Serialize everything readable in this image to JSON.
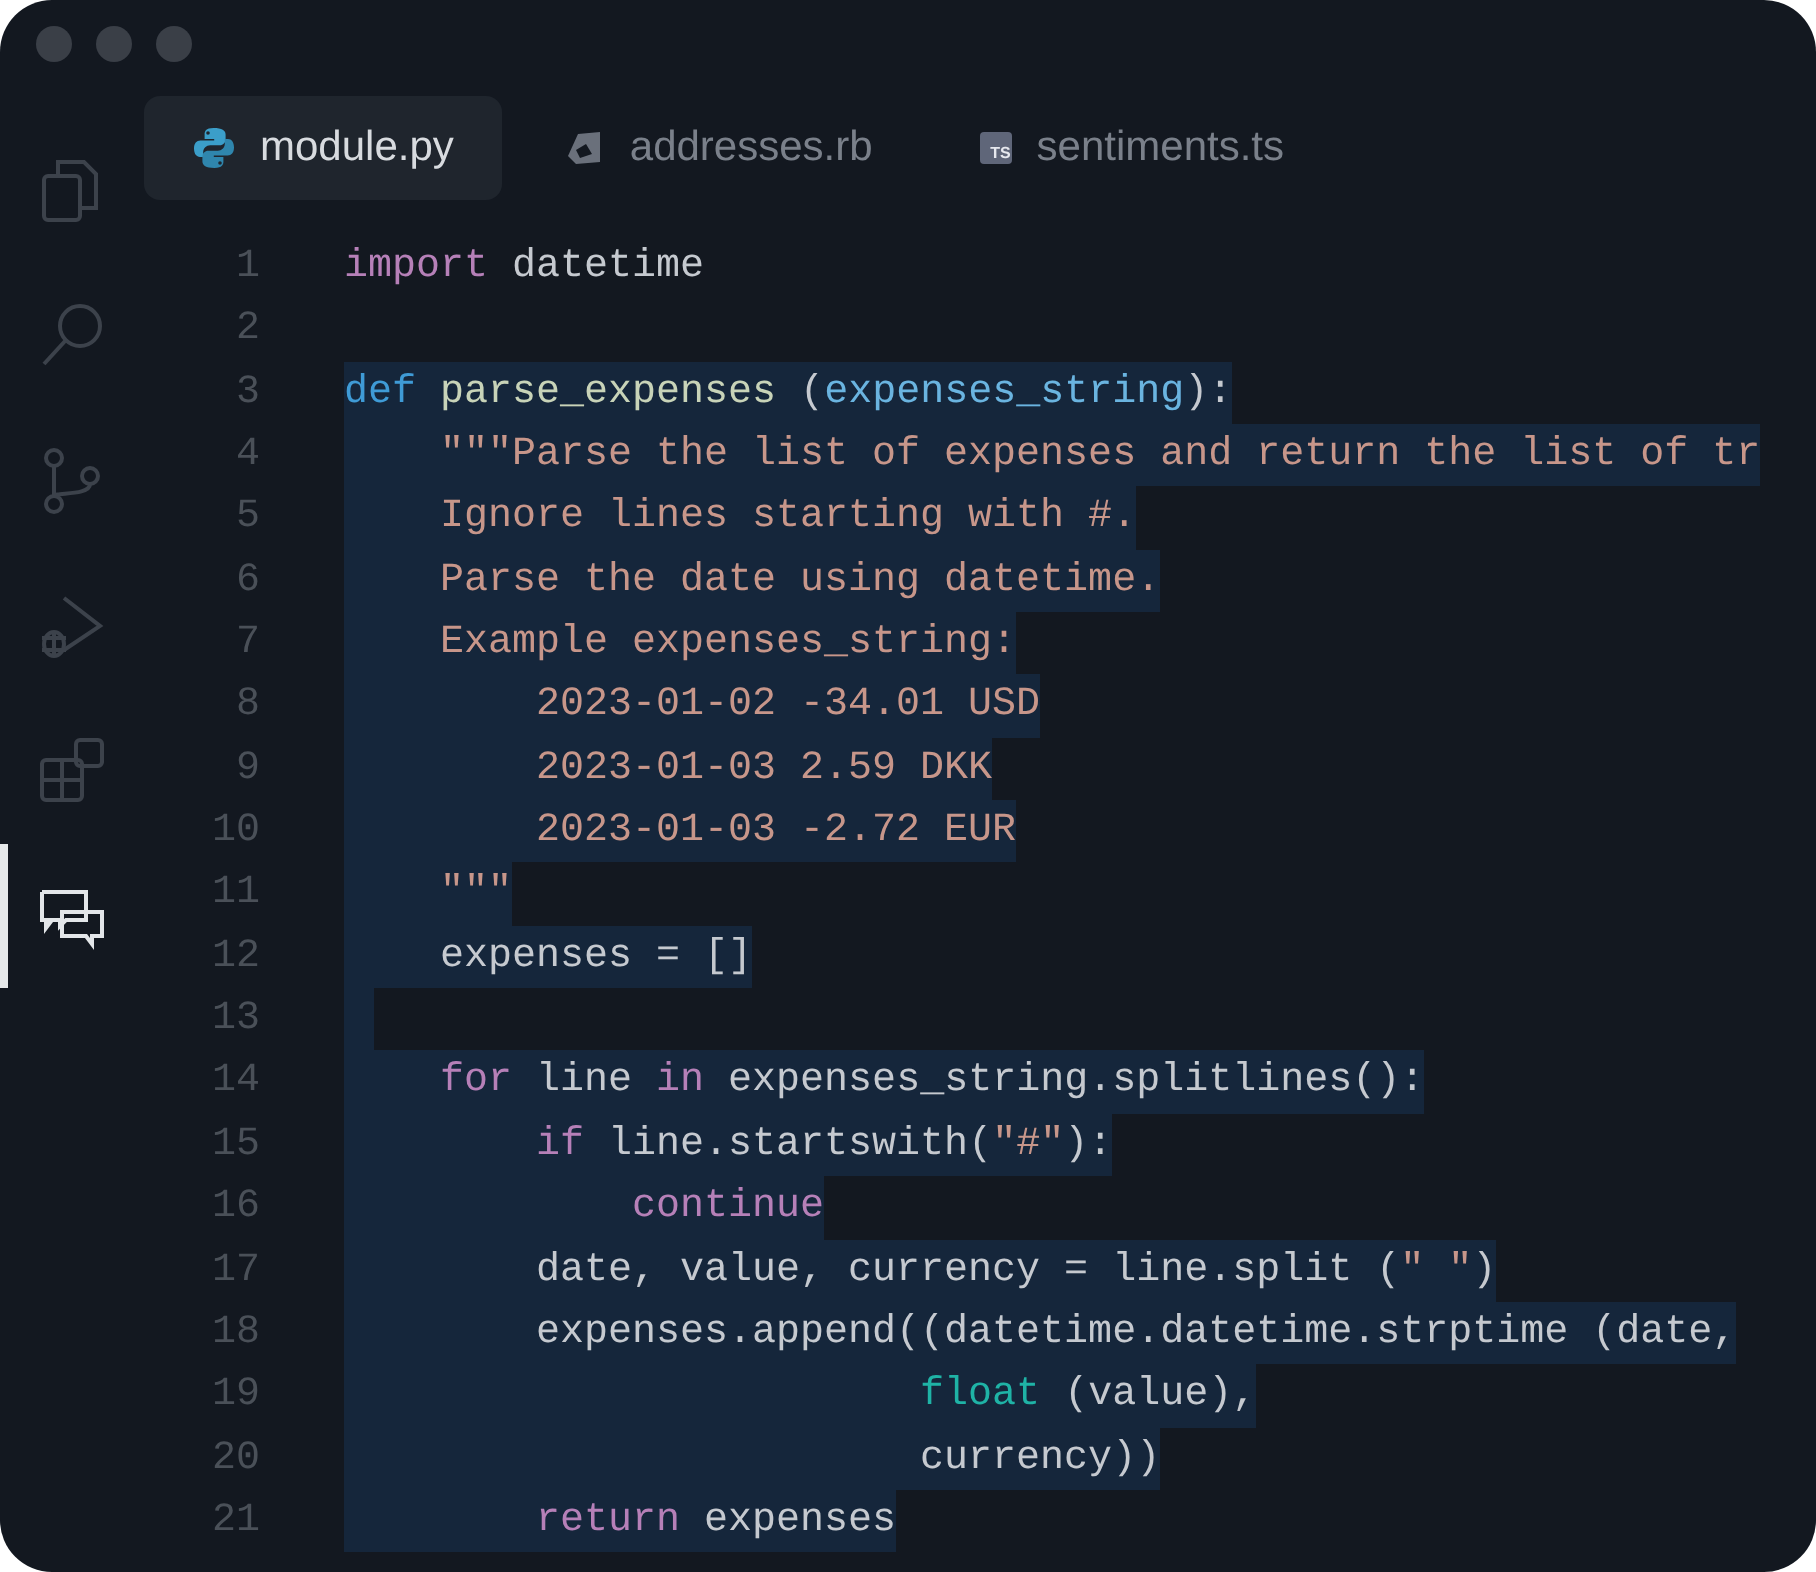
{
  "activity_bar": [
    {
      "kind": "files",
      "selected": false
    },
    {
      "kind": "search",
      "selected": false
    },
    {
      "kind": "branch",
      "selected": false
    },
    {
      "kind": "debug",
      "selected": false
    },
    {
      "kind": "extensions",
      "selected": false
    },
    {
      "kind": "chat",
      "selected": true
    }
  ],
  "tabs": [
    {
      "label": "module.py",
      "kind": "python",
      "selected": true
    },
    {
      "label": "addresses.rb",
      "kind": "ruby",
      "selected": false
    },
    {
      "label": "sentiments.ts",
      "kind": "typescript",
      "icon_text": "TS",
      "selected": false
    }
  ],
  "editor": {
    "lines": [
      {
        "number": "1",
        "selected": false,
        "tokens": [
          {
            "kind": "keyword",
            "text": "import"
          },
          {
            "kind": "plain",
            "text": " datetime"
          }
        ]
      },
      {
        "number": "2",
        "selected": false
      },
      {
        "number": "3",
        "selected": true,
        "tokens": [
          {
            "kind": "def",
            "text": "def"
          },
          {
            "kind": "function",
            "text": " parse_expenses "
          },
          {
            "kind": "plain",
            "text": "("
          },
          {
            "kind": "param",
            "text": "expenses_string"
          },
          {
            "kind": "plain",
            "text": "):"
          }
        ]
      },
      {
        "number": "4",
        "selected": true,
        "tokens": [
          {
            "kind": "string",
            "text": "    \"\"\"Parse the list of expenses and return the list of tr"
          }
        ]
      },
      {
        "number": "5",
        "selected": true,
        "tokens": [
          {
            "kind": "string",
            "text": "    Ignore lines starting with #."
          }
        ]
      },
      {
        "number": "6",
        "selected": true,
        "tokens": [
          {
            "kind": "string",
            "text": "    Parse the date using datetime."
          }
        ]
      },
      {
        "number": "7",
        "selected": true,
        "tokens": [
          {
            "kind": "string",
            "text": "    Example expenses_string:"
          }
        ]
      },
      {
        "number": "8",
        "selected": true,
        "tokens": [
          {
            "kind": "string",
            "text": "        2023-01-02 -34.01 USD"
          }
        ]
      },
      {
        "number": "9",
        "selected": true,
        "tokens": [
          {
            "kind": "string",
            "text": "        2023-01-03 2.59 DKK"
          }
        ]
      },
      {
        "number": "10",
        "selected": true,
        "tokens": [
          {
            "kind": "string",
            "text": "        2023-01-03 -2.72 EUR"
          }
        ]
      },
      {
        "number": "11",
        "selected": true,
        "tokens": [
          {
            "kind": "string",
            "text": "    \"\"\""
          }
        ]
      },
      {
        "number": "12",
        "selected": true,
        "tokens": [
          {
            "kind": "plain",
            "text": "    expenses = []"
          }
        ]
      },
      {
        "number": "13",
        "selected": true
      },
      {
        "number": "14",
        "selected": true,
        "tokens": [
          {
            "kind": "keyword",
            "text": "    for"
          },
          {
            "kind": "plain",
            "text": " line "
          },
          {
            "kind": "keyword",
            "text": "in"
          },
          {
            "kind": "plain",
            "text": " expenses_string.splitlines():"
          }
        ]
      },
      {
        "number": "15",
        "selected": true,
        "tokens": [
          {
            "kind": "keyword",
            "text": "        if"
          },
          {
            "kind": "plain",
            "text": " line.startswith("
          },
          {
            "kind": "string",
            "text": "\"#\""
          },
          {
            "kind": "plain",
            "text": "):"
          }
        ]
      },
      {
        "number": "16",
        "selected": true,
        "tokens": [
          {
            "kind": "keyword",
            "text": "            continue"
          }
        ]
      },
      {
        "number": "17",
        "selected": true,
        "tokens": [
          {
            "kind": "plain",
            "text": "        date, value, currency = line.split ("
          },
          {
            "kind": "string",
            "text": "\" \""
          },
          {
            "kind": "plain",
            "text": ")"
          }
        ]
      },
      {
        "number": "18",
        "selected": true,
        "tokens": [
          {
            "kind": "plain",
            "text": "        expenses.append((datetime.datetime.strptime (date,"
          }
        ]
      },
      {
        "number": "19",
        "selected": true,
        "tokens": [
          {
            "kind": "builtin",
            "text": "                        float"
          },
          {
            "kind": "plain",
            "text": " (value),"
          }
        ]
      },
      {
        "number": "20",
        "selected": true,
        "tokens": [
          {
            "kind": "plain",
            "text": "                        currency))"
          }
        ]
      },
      {
        "number": "21",
        "selected": true,
        "tokens": [
          {
            "kind": "keyword",
            "text": "        return"
          },
          {
            "kind": "plain",
            "text": " expenses"
          }
        ]
      }
    ]
  }
}
